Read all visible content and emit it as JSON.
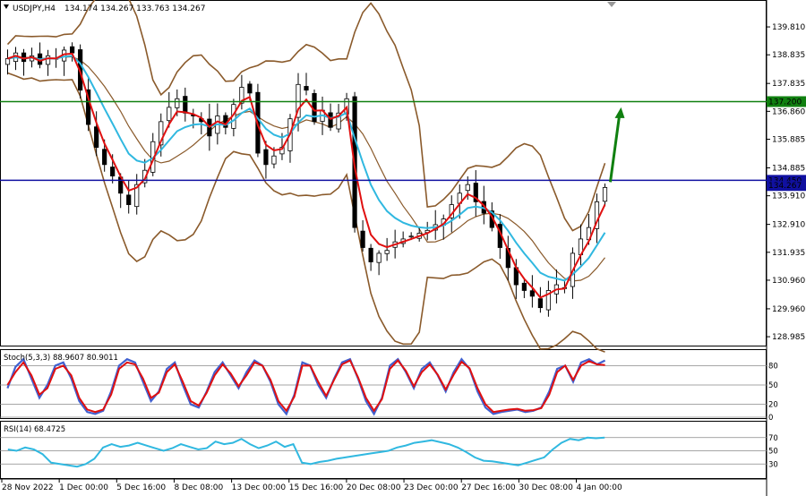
{
  "header": {
    "symbol": "USDJPY,H4",
    "ohlc": "134.174 134.267 133.763 134.267"
  },
  "colors": {
    "hline_blue": "#1010a0",
    "hline_green": "#108010",
    "candle": "#000000",
    "ema_fast": "#e01010",
    "ema_slow": "#30b8e0",
    "bollinger": "#8a5a2b",
    "stoch_main": "#4060d0",
    "stoch_signal": "#e01010",
    "rsi": "#30b8e0",
    "arrow": "#108010"
  },
  "chart_data": {
    "type": "candlestick",
    "title": "USDJPY,H4",
    "ylim": [
      128.8,
      140.5
    ],
    "y_ticks": [
      "139.810",
      "138.835",
      "137.835",
      "136.860",
      "135.885",
      "134.885",
      "133.910",
      "132.910",
      "131.935",
      "130.960",
      "129.960",
      "128.985"
    ],
    "x_ticks": [
      "28 Nov 2022",
      "1 Dec 00:00",
      "5 Dec 16:00",
      "8 Dec 08:00",
      "13 Dec 00:00",
      "15 Dec 16:00",
      "20 Dec 08:00",
      "23 Dec 00:00",
      "27 Dec 16:00",
      "30 Dec 08:00",
      "4 Jan 00:00"
    ],
    "horizontal_lines": [
      {
        "price": 137.2,
        "label": "137.200",
        "color": "#108010"
      },
      {
        "price": 134.45,
        "label": "134.450",
        "color": "#1010a0"
      }
    ],
    "current_price": {
      "price": 134.267,
      "label": "134.267"
    },
    "close_path": [
      138.7,
      138.9,
      138.6,
      138.8,
      138.5,
      138.8,
      138.7,
      139.0,
      138.9,
      137.6,
      136.4,
      135.6,
      135.0,
      134.6,
      134.0,
      133.6,
      134.3,
      134.8,
      135.8,
      136.5,
      137.0,
      137.3,
      136.8,
      136.7,
      136.5,
      136.0,
      136.7,
      136.3,
      137.1,
      137.7,
      137.5,
      135.4,
      135.0,
      135.3,
      135.6,
      136.6,
      137.8,
      137.6,
      136.5,
      136.9,
      136.3,
      136.8,
      137.3,
      132.8,
      132.1,
      131.6,
      131.9,
      132.0,
      132.3,
      132.4,
      132.5,
      132.6,
      132.7,
      132.9,
      133.1,
      133.6,
      134.0,
      134.3,
      133.7,
      133.3,
      132.8,
      132.1,
      131.4,
      130.8,
      130.6,
      130.4,
      130.0,
      130.6,
      130.8,
      130.7,
      131.9,
      132.4,
      132.8,
      133.7,
      134.2
    ],
    "arrow_target": 137.0,
    "stochastic": {
      "label": "Stoch(5,3,3) 88.9607 80.9011",
      "ylim": [
        0,
        100
      ],
      "levels": [
        80,
        50,
        20,
        0
      ],
      "level_labels": [
        "80",
        "50",
        "20",
        "0"
      ],
      "main": [
        45,
        78,
        90,
        60,
        30,
        50,
        80,
        85,
        60,
        25,
        8,
        5,
        10,
        40,
        80,
        90,
        85,
        55,
        25,
        40,
        75,
        85,
        50,
        20,
        15,
        40,
        70,
        85,
        65,
        45,
        70,
        88,
        80,
        55,
        20,
        5,
        35,
        85,
        80,
        50,
        30,
        60,
        85,
        90,
        60,
        25,
        5,
        30,
        80,
        90,
        70,
        45,
        75,
        85,
        65,
        40,
        70,
        90,
        75,
        40,
        15,
        5,
        8,
        10,
        12,
        8,
        10,
        15,
        40,
        75,
        80,
        55,
        85,
        90,
        82,
        88
      ],
      "signal": [
        50,
        70,
        85,
        65,
        35,
        45,
        75,
        80,
        65,
        30,
        12,
        8,
        12,
        35,
        75,
        85,
        82,
        60,
        30,
        38,
        70,
        82,
        55,
        25,
        18,
        38,
        65,
        82,
        68,
        48,
        65,
        85,
        80,
        58,
        25,
        10,
        32,
        80,
        80,
        55,
        33,
        58,
        82,
        88,
        62,
        30,
        10,
        28,
        75,
        88,
        72,
        48,
        70,
        82,
        66,
        43,
        66,
        86,
        76,
        45,
        20,
        8,
        10,
        12,
        13,
        10,
        11,
        14,
        35,
        70,
        80,
        58,
        80,
        87,
        82,
        81
      ]
    },
    "rsi": {
      "label": "RSI(14) 68.4725",
      "ylim": [
        0,
        100
      ],
      "levels": [
        70,
        50,
        30
      ],
      "level_labels": [
        "70",
        "50",
        "30"
      ],
      "values": [
        52,
        50,
        55,
        52,
        45,
        32,
        30,
        28,
        26,
        30,
        38,
        55,
        60,
        56,
        58,
        62,
        58,
        54,
        50,
        54,
        60,
        56,
        52,
        54,
        64,
        60,
        62,
        68,
        60,
        54,
        58,
        64,
        56,
        60,
        32,
        30,
        33,
        35,
        38,
        40,
        42,
        44,
        46,
        48,
        50,
        55,
        58,
        62,
        64,
        66,
        63,
        60,
        55,
        48,
        40,
        35,
        34,
        32,
        30,
        28,
        32,
        36,
        40,
        52,
        62,
        68,
        66,
        70,
        69,
        70
      ]
    }
  }
}
